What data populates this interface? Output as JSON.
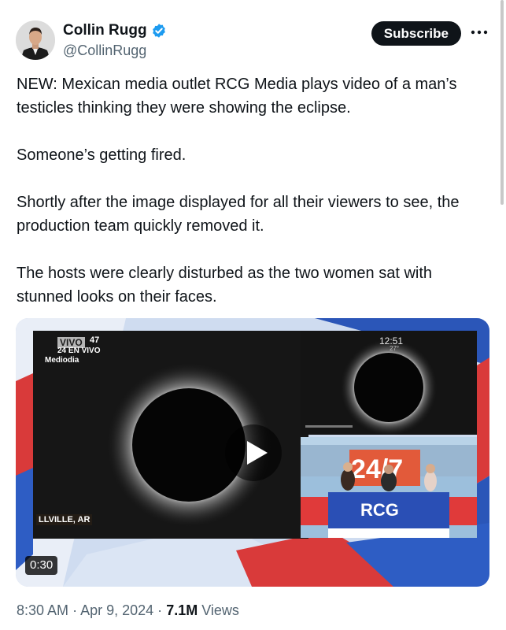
{
  "author": {
    "display_name": "Collin Rugg",
    "handle": "@CollinRugg",
    "verified": true
  },
  "actions": {
    "subscribe_label": "Subscribe",
    "more_icon": "more-horizontal-icon"
  },
  "tweet": {
    "paragraphs": [
      "NEW: Mexican media outlet RCG Media plays video of a man’s testicles thinking they were showing the eclipse.",
      "Someone’s getting fired.",
      "Shortly after the image displayed for all their viewers to see, the production team quickly removed it.",
      "The hosts were clearly disturbed as the two women sat with stunned looks on their faces."
    ]
  },
  "media": {
    "type": "video",
    "duration": "0:30",
    "play_icon": "play-icon",
    "broadcast": {
      "live_label": "VIVO",
      "viewers": "47",
      "channel": "24 EN VIVO",
      "program": "Mediodia",
      "location": "LLVILLE, AR",
      "clock": "12:51",
      "temperature": "27°",
      "studio_logo": "RCG",
      "studio_number": "24/7"
    }
  },
  "meta": {
    "time": "8:30 AM",
    "date": "Apr 9, 2024",
    "views_count": "7.1M",
    "views_label": "Views",
    "separator": "·"
  },
  "colors": {
    "text": "#0f1419",
    "secondary": "#536471",
    "verified": "#1d9bf0",
    "button": "#0f1419"
  }
}
